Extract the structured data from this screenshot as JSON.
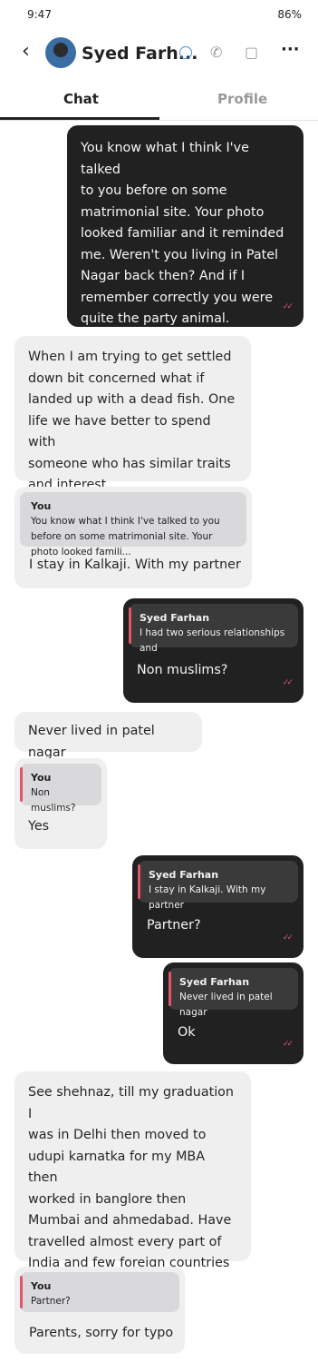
{
  "status_bar": {
    "time": "9:47",
    "battery": "86%"
  },
  "header": {
    "back_icon": "chevron-left",
    "contact_name": "Syed Farh...",
    "icons": [
      "verified-icon",
      "phone-icon",
      "video-icon",
      "more-icon"
    ]
  },
  "tabs": [
    {
      "label": "Chat",
      "active": true
    },
    {
      "label": "Profile",
      "active": false
    }
  ],
  "messages": [
    {
      "dir": "out",
      "text": "You know what I think I've talked\nto you before on some\nmatrimonial site. Your photo\nlooked familiar and it reminded\nme. Weren't you living in Patel\nNagar back then? And if I\nremember correctly you were\nquite the party animal."
    },
    {
      "dir": "in",
      "text": "When I am trying to get settled\ndown bit concerned what if\nlanded up with a dead fish. One\nlife we have better to spend with\nsomeone who has similar traits\nand interest."
    },
    {
      "dir": "in",
      "quote_name": "You",
      "quote_text": "You know what I think I've talked to you before on some matrimonial site. Your photo looked famili...",
      "text": "I stay in Kalkaji. With my partner"
    },
    {
      "dir": "out",
      "quote_name": "Syed Farhan",
      "quote_text": "I had two serious relationships and",
      "text": "Non muslims?"
    },
    {
      "dir": "in",
      "text": "Never lived in patel nagar"
    },
    {
      "dir": "in",
      "quote_name": "You",
      "quote_text": "Non muslims?",
      "text": "Yes"
    },
    {
      "dir": "out",
      "quote_name": "Syed Farhan",
      "quote_text": "I stay in Kalkaji. With my partner",
      "text": "Partner?"
    },
    {
      "dir": "out",
      "quote_name": "Syed Farhan",
      "quote_text": "Never lived in patel nagar",
      "text": "Ok"
    },
    {
      "dir": "in",
      "text": "See shehnaz, till my graduation I\nwas in Delhi then moved to\nudupi karnatka for my MBA then\nworked in banglore then\nMumbai and ahmedabad. Have\ntravelled almost every part of\nIndia and few foreign countries\nas well."
    },
    {
      "dir": "in",
      "quote_name": "You",
      "quote_text": "Partner?",
      "text": "Parents, sorry for typo"
    }
  ],
  "colors": {
    "outgoing_bubble": "#212121",
    "incoming_bubble": "#efeff0",
    "accent": "#e0566b"
  }
}
